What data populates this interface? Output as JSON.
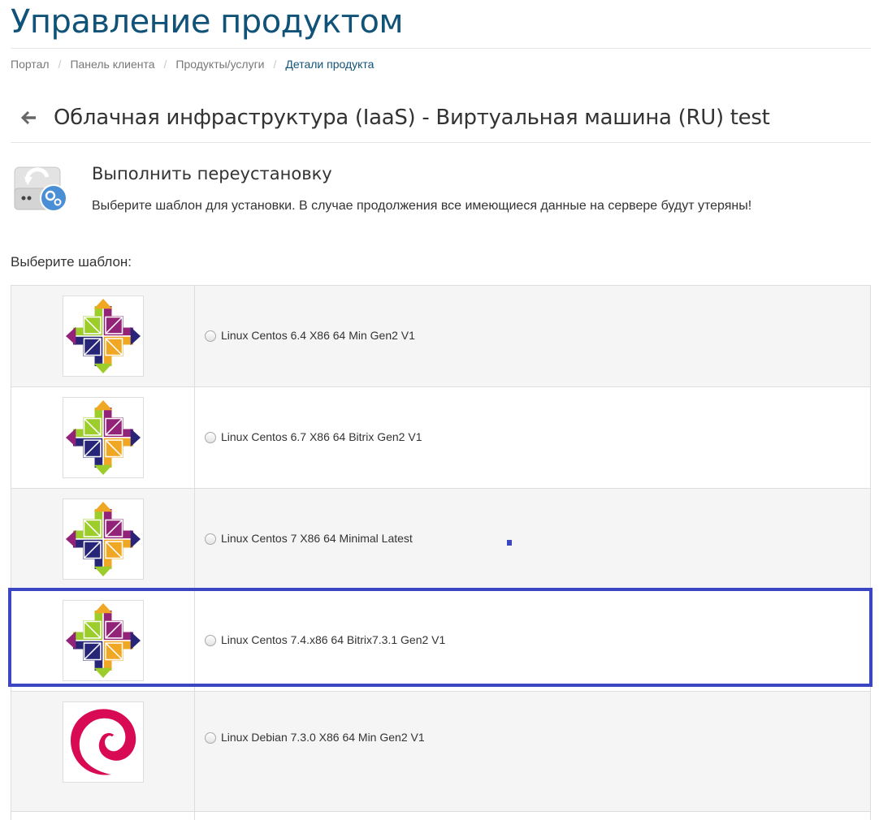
{
  "page": {
    "title": "Управление продуктом"
  },
  "breadcrumb": [
    {
      "label": "Портал"
    },
    {
      "label": "Панель клиента"
    },
    {
      "label": "Продукты/услуги"
    },
    {
      "label": "Детали продукта"
    }
  ],
  "product": {
    "name": "Облачная инфраструктура (IaaS) - Виртуальная машина (RU) test"
  },
  "reinstall": {
    "title": "Выполнить переустановку",
    "description": "Выберите шаблон для установки. В случае продолжения все имеющиеся данные на сервере будут утеряны!"
  },
  "templates": {
    "label": "Выберите шаблон:",
    "items": [
      {
        "name": "Linux Centos 6.4 X86 64 Min Gen2 V1",
        "logo": "centos-logo-icon",
        "selected": false
      },
      {
        "name": "Linux Centos 6.7 X86 64 Bitrix Gen2 V1",
        "logo": "centos-logo-icon",
        "selected": false
      },
      {
        "name": "Linux Centos 7 X86 64 Minimal Latest",
        "logo": "centos-logo-icon",
        "selected": false
      },
      {
        "name": "Linux Centos 7.4.x86 64 Bitrix7.3.1 Gen2 V1",
        "logo": "centos-logo-icon",
        "selected": false
      },
      {
        "name": "Linux Debian 7.3.0 X86 64 Min Gen2 V1",
        "logo": "debian-logo-icon",
        "selected": false
      }
    ]
  },
  "colors": {
    "title": "#115378",
    "highlight": "#3d46c2",
    "centos_green": "#9ccd2a",
    "centos_purple": "#932279",
    "centos_orange": "#efa724",
    "centos_navy": "#262577",
    "debian_red": "#d70a53"
  }
}
